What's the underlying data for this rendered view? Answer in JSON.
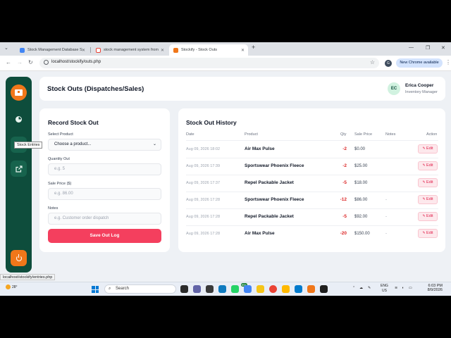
{
  "browser": {
    "tabs": [
      {
        "label": "Stock Management Database S",
        "favicon_color": "#4285f4"
      },
      {
        "label": "stock management system from",
        "favicon_color": "#ea4335"
      },
      {
        "label": "Stockify - Stock Outs",
        "favicon_color": "#f0771a"
      }
    ],
    "url": "localhost/stockify/outs.php",
    "profile_initial": "G",
    "new_chrome_label": "New Chrome available",
    "status_url": "localhost/stockify/entries.php"
  },
  "sidebar": {
    "tooltip": "Stock Entries"
  },
  "header": {
    "title": "Stock Outs (Dispatches/Sales)",
    "avatar_initials": "EC",
    "user_name": "Erica Cooper",
    "user_role": "Inventory Manager"
  },
  "record_form": {
    "title": "Record Stock Out",
    "product_label": "Select Product",
    "product_value": "Choose a product...",
    "quantity_label": "Quantity Out",
    "quantity_placeholder": "e.g. 5",
    "price_label": "Sale Price ($)",
    "price_placeholder": "e.g. 86.00",
    "notes_label": "Notes",
    "notes_placeholder": "e.g. Customer order dispatch",
    "save_label": "Save Out Log"
  },
  "history": {
    "title": "Stock Out History",
    "columns": [
      "Date",
      "Product",
      "Qty",
      "Sale Price",
      "Notes",
      "Action"
    ],
    "edit_label": "Edit",
    "rows": [
      {
        "date": "Aug 09, 2026 18:02",
        "product": "Air Max Pulse",
        "qty": "-2",
        "price": "$0.00",
        "notes": ""
      },
      {
        "date": "Aug 09, 2026 17:39",
        "product": "Sportswear Phoenix Fleece",
        "qty": "-2",
        "price": "$25.00",
        "notes": ""
      },
      {
        "date": "Aug 09, 2026 17:37",
        "product": "Repel Packable Jacket",
        "qty": "-5",
        "price": "$18.00",
        "notes": ""
      },
      {
        "date": "Aug 09, 2026 17:28",
        "product": "Sportswear Phoenix Fleece",
        "qty": "-12",
        "price": "$86.00",
        "notes": "-"
      },
      {
        "date": "Aug 09, 2026 17:28",
        "product": "Repel Packable Jacket",
        "qty": "-5",
        "price": "$92.00",
        "notes": "-"
      },
      {
        "date": "Aug 09, 2026 17:28",
        "product": "Air Max Pulse",
        "qty": "-20",
        "price": "$150.00",
        "notes": "-"
      }
    ]
  },
  "taskbar": {
    "weather": "28°",
    "search_label": "Search",
    "language": "ENG",
    "region": "US",
    "time": "6:03 PM",
    "date": "8/9/2026",
    "notification_badge": "99+"
  },
  "colors": {
    "sidebar": "#0e4d3c",
    "accent_orange": "#f0771a",
    "primary_button": "#f43f5e",
    "negative_qty": "#dc2626"
  }
}
